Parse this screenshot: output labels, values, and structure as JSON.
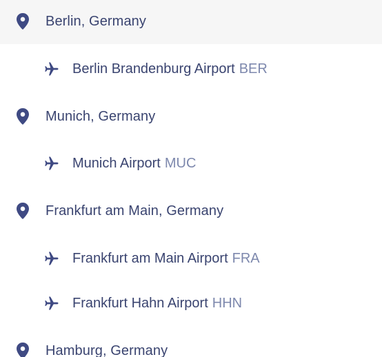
{
  "colors": {
    "icon": "#3f4a83",
    "text": "#3a4470",
    "code": "#7d88ad",
    "highlight_bg": "#f6f6f6"
  },
  "results": [
    {
      "city": "Berlin, Germany",
      "icon": "map-pin-icon",
      "airports": [
        {
          "name": "Berlin Brandenburg Airport",
          "code": "BER",
          "icon": "airplane-icon"
        }
      ]
    },
    {
      "city": "Munich, Germany",
      "icon": "map-pin-icon",
      "airports": [
        {
          "name": "Munich Airport",
          "code": "MUC",
          "icon": "airplane-icon"
        }
      ]
    },
    {
      "city": "Frankfurt am Main, Germany",
      "icon": "map-pin-icon",
      "airports": [
        {
          "name": "Frankfurt am Main Airport",
          "code": "FRA",
          "icon": "airplane-icon"
        },
        {
          "name": "Frankfurt Hahn Airport",
          "code": "HHN",
          "icon": "airplane-icon"
        }
      ]
    },
    {
      "city": "Hamburg, Germany",
      "icon": "map-pin-icon",
      "airports": []
    }
  ]
}
